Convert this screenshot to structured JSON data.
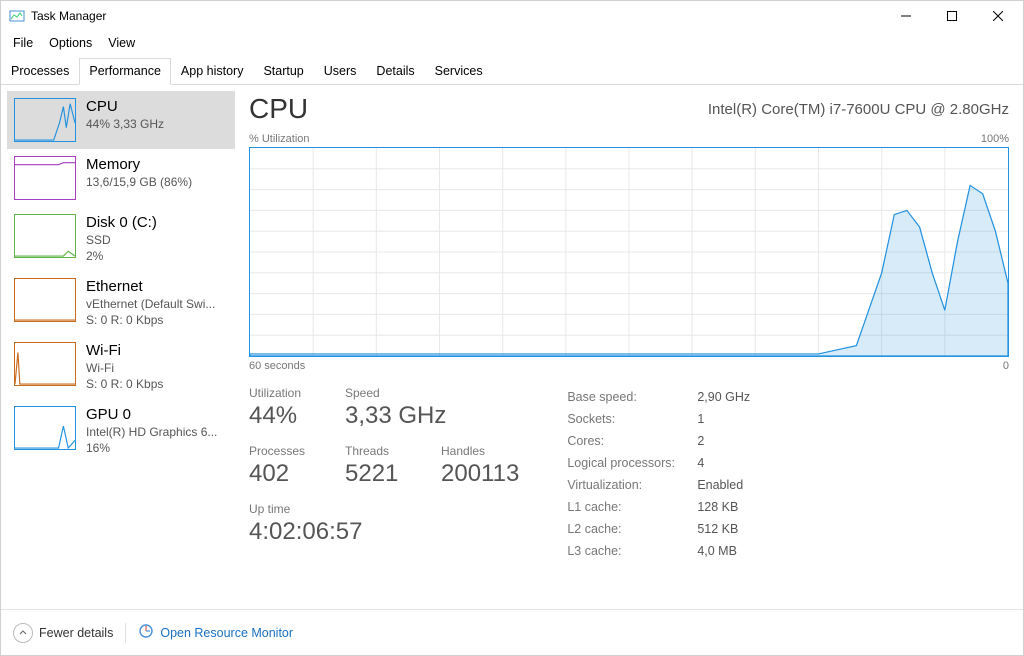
{
  "window": {
    "title": "Task Manager"
  },
  "menus": {
    "file": "File",
    "options": "Options",
    "view": "View"
  },
  "tabs": {
    "processes": "Processes",
    "performance": "Performance",
    "apphistory": "App history",
    "startup": "Startup",
    "users": "Users",
    "details": "Details",
    "services": "Services"
  },
  "sidebar": {
    "cpu": {
      "title": "CPU",
      "sub": "44%  3,33 GHz"
    },
    "memory": {
      "title": "Memory",
      "sub": "13,6/15,9 GB (86%)"
    },
    "disk": {
      "title": "Disk 0 (C:)",
      "sub1": "SSD",
      "sub2": "2%"
    },
    "eth": {
      "title": "Ethernet",
      "sub1": "vEthernet (Default Swi...",
      "sub2": "S: 0  R: 0 Kbps"
    },
    "wifi": {
      "title": "Wi-Fi",
      "sub1": "Wi-Fi",
      "sub2": "S: 0  R: 0 Kbps"
    },
    "gpu": {
      "title": "GPU 0",
      "sub1": "Intel(R) HD Graphics 6...",
      "sub2": "16%"
    }
  },
  "header": {
    "heading": "CPU",
    "cpuName": "Intel(R) Core(TM) i7-7600U CPU @ 2.80GHz"
  },
  "chart": {
    "topLeft": "% Utilization",
    "topRight": "100%",
    "botLeft": "60 seconds",
    "botRight": "0"
  },
  "stats": {
    "utilization": {
      "label": "Utilization",
      "value": "44%"
    },
    "speed": {
      "label": "Speed",
      "value": "3,33 GHz"
    },
    "processes": {
      "label": "Processes",
      "value": "402"
    },
    "threads": {
      "label": "Threads",
      "value": "5221"
    },
    "handles": {
      "label": "Handles",
      "value": "200113"
    },
    "uptime": {
      "label": "Up time",
      "value": "4:02:06:57"
    }
  },
  "specs": {
    "basespeed": {
      "k": "Base speed:",
      "v": "2,90 GHz"
    },
    "sockets": {
      "k": "Sockets:",
      "v": "1"
    },
    "cores": {
      "k": "Cores:",
      "v": "2"
    },
    "logical": {
      "k": "Logical processors:",
      "v": "4"
    },
    "virt": {
      "k": "Virtualization:",
      "v": "Enabled"
    },
    "l1": {
      "k": "L1 cache:",
      "v": "128 KB"
    },
    "l2": {
      "k": "L2 cache:",
      "v": "512 KB"
    },
    "l3": {
      "k": "L3 cache:",
      "v": "4,0 MB"
    }
  },
  "footer": {
    "fewer": "Fewer details",
    "resmon": "Open Resource Monitor"
  },
  "chart_data": {
    "type": "line",
    "title": "CPU % Utilization",
    "xlabel": "seconds",
    "ylabel": "% Utilization",
    "xlim": [
      60,
      0
    ],
    "ylim": [
      0,
      100
    ],
    "x": [
      60,
      55,
      50,
      45,
      40,
      35,
      30,
      25,
      20,
      15,
      12,
      10,
      9,
      8,
      7,
      6,
      5,
      4,
      3,
      2,
      1,
      0
    ],
    "values": [
      1,
      1,
      1,
      1,
      1,
      1,
      1,
      1,
      1,
      1,
      5,
      40,
      68,
      70,
      62,
      40,
      22,
      55,
      82,
      78,
      60,
      35
    ]
  }
}
